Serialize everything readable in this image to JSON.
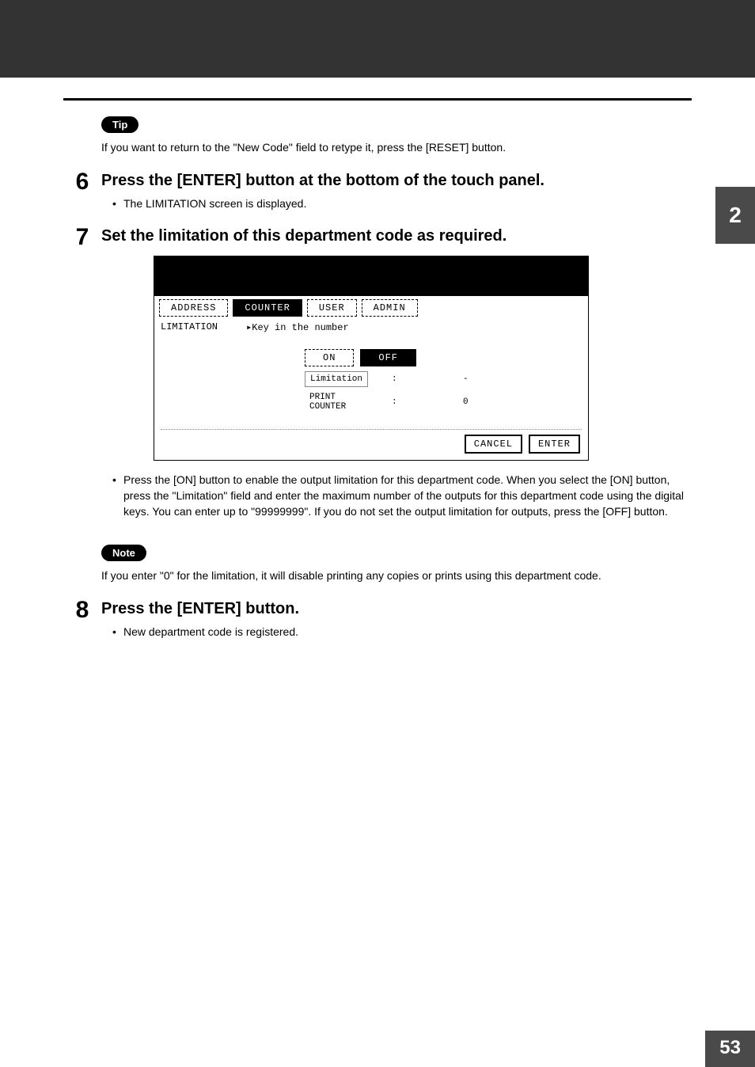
{
  "sideTab": "2",
  "pageNumber": "53",
  "tip": {
    "label": "Tip",
    "text": "If you want to return to the \"New Code\" field to retype it, press the [RESET] button."
  },
  "steps": {
    "s6": {
      "num": "6",
      "title": "Press the [ENTER] button at the bottom of the touch panel.",
      "bullets": [
        "The LIMITATION screen is displayed."
      ]
    },
    "s7": {
      "num": "7",
      "title": "Set the limitation of this department code as required.",
      "bullets": [
        "Press the [ON] button to enable the output limitation for this department code. When you select the [ON] button, press the \"Limitation\" field and enter the maximum number of the outputs for this department code using the digital keys. You can enter up to \"99999999\". If you do not set the output limitation for outputs, press the [OFF] button."
      ]
    },
    "s8": {
      "num": "8",
      "title": "Press the [ENTER] button.",
      "bullets": [
        "New department code is registered."
      ]
    }
  },
  "screenshot": {
    "tabs": [
      "ADDRESS",
      "COUNTER",
      "USER",
      "ADMIN"
    ],
    "label": "LIMITATION",
    "hint": "▸Key in the number",
    "onLabel": "ON",
    "offLabel": "OFF",
    "limitationLabel": "Limitation",
    "limitationValue": "-",
    "printCounterLabel": "PRINT\nCOUNTER",
    "printCounterValue": "0",
    "cancel": "CANCEL",
    "enter": "ENTER"
  },
  "note": {
    "label": "Note",
    "text": "If you enter \"0\" for the limitation, it will disable printing any copies or prints using this department code."
  }
}
